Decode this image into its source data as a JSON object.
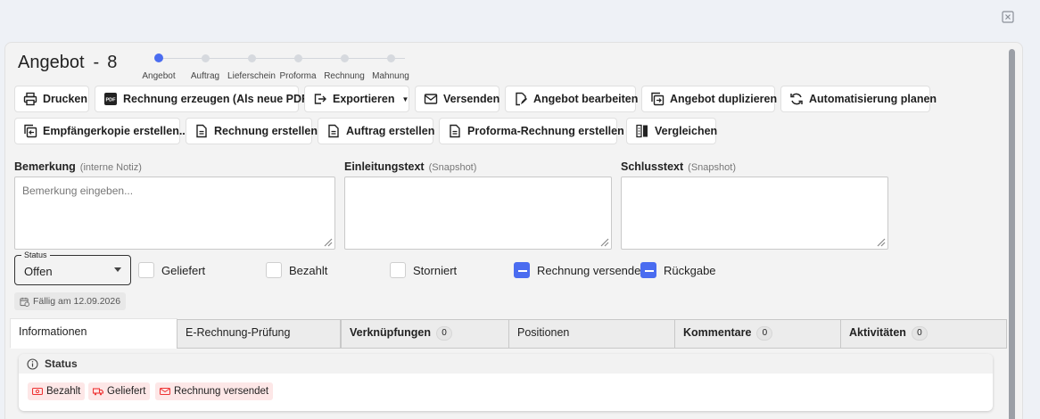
{
  "window": {
    "close_icon": "close-square-icon"
  },
  "header": {
    "title": "Angebot",
    "separator": "-",
    "number": "8"
  },
  "stepper": {
    "steps": [
      {
        "label": "Angebot",
        "active": true
      },
      {
        "label": "Auftrag",
        "active": false
      },
      {
        "label": "Lieferschein",
        "active": false
      },
      {
        "label": "Proforma",
        "active": false
      },
      {
        "label": "Rechnung",
        "active": false
      },
      {
        "label": "Mahnung",
        "active": false
      }
    ]
  },
  "actions": {
    "print": "Drucken",
    "invoice_pdf": "Rechnung erzeugen (Als neue PDF)",
    "export": "Exportieren",
    "send": "Versenden",
    "edit_offer": "Angebot bearbeiten",
    "duplicate_offer": "Angebot duplizieren",
    "schedule_automation": "Automatisierung planen",
    "recipient_copy": "Empfängerkopie erstellen...",
    "create_invoice": "Rechnung erstellen",
    "create_order": "Auftrag erstellen",
    "create_proforma": "Proforma-Rechnung erstellen",
    "compare": "Vergleichen"
  },
  "notes": {
    "remark_label": "Bemerkung",
    "remark_sub": "(interne Notiz)",
    "remark_placeholder": "Bemerkung eingeben...",
    "intro_label": "Einleitungstext",
    "intro_sub": "(Snapshot)",
    "closing_label": "Schlusstext",
    "closing_sub": "(Snapshot)"
  },
  "status": {
    "legend": "Status",
    "value": "Offen",
    "checkboxes": [
      {
        "label": "Geliefert",
        "checked": false
      },
      {
        "label": "Bezahlt",
        "checked": false
      },
      {
        "label": "Storniert",
        "checked": false
      },
      {
        "label": "Rechnung versendet",
        "checked": true
      },
      {
        "label": "Rückgabe",
        "checked": true
      }
    ],
    "due": "Fällig am 12.09.2026"
  },
  "tabs": [
    {
      "label": "Informationen",
      "active": true
    },
    {
      "label": "E-Rechnung-Prüfung"
    },
    {
      "label": "Verknüpfungen",
      "count": "0"
    },
    {
      "label": "Positionen"
    },
    {
      "label": "Kommentare",
      "count": "0"
    },
    {
      "label": "Aktivitäten",
      "count": "0"
    }
  ],
  "status_card": {
    "title": "Status",
    "badges": [
      "Bezahlt",
      "Geliefert",
      "Rechnung versendet"
    ]
  },
  "colors": {
    "accent": "#4a6cf0",
    "badge_bg": "#fde7e7",
    "badge_icon": "#e33333"
  }
}
